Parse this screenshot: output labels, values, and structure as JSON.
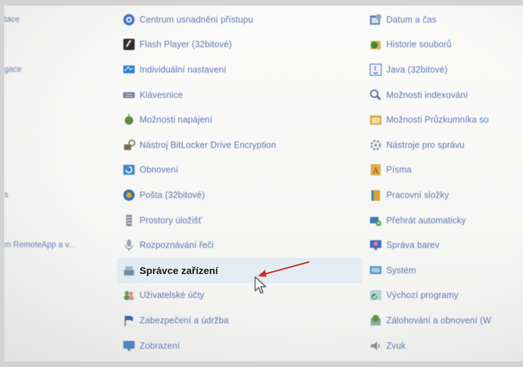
{
  "left_column": [
    {
      "label": "tace",
      "icon": ""
    },
    {
      "label": "",
      "icon": ""
    },
    {
      "label": "gace",
      "icon": ""
    },
    {
      "label": "",
      "icon": ""
    },
    {
      "label": "",
      "icon": ""
    },
    {
      "label": "",
      "icon": ""
    },
    {
      "label": "",
      "icon": ""
    },
    {
      "label": "s",
      "icon": ""
    },
    {
      "label": "",
      "icon": ""
    },
    {
      "label": "m RemoteApp a v...",
      "icon": ""
    },
    {
      "label": "",
      "icon": ""
    },
    {
      "label": "",
      "icon": ""
    },
    {
      "label": "",
      "icon": ""
    },
    {
      "label": "",
      "icon": ""
    }
  ],
  "middle_column": [
    {
      "label": "Centrum usnadnění přístupu",
      "icon": "ease-of-access-icon",
      "color": "#3a6fc4"
    },
    {
      "label": "Flash Player (32bitové)",
      "icon": "flash-player-icon",
      "color": "#2a2a2a"
    },
    {
      "label": "Individuální nastavení",
      "icon": "personalization-icon",
      "color": "#2e7fd6"
    },
    {
      "label": "Klávesnice",
      "icon": "keyboard-icon",
      "color": "#5a6a80"
    },
    {
      "label": "Možnosti napájení",
      "icon": "power-options-icon",
      "color": "#5f8a3a"
    },
    {
      "label": "Nástroj BitLocker Drive Encryption",
      "icon": "bitlocker-icon",
      "color": "#7a6a50"
    },
    {
      "label": "Obnovení",
      "icon": "recovery-icon",
      "color": "#3b86c8"
    },
    {
      "label": "Pošta (32bitové)",
      "icon": "mail-icon",
      "color": "#2f6fb8"
    },
    {
      "label": "Prostory úložišť",
      "icon": "storage-spaces-icon",
      "color": "#8a8a9a"
    },
    {
      "label": "Rozpoznávání řeči",
      "icon": "speech-recognition-icon",
      "color": "#9aa2ad"
    },
    {
      "label": "Správce zařízení",
      "icon": "device-manager-icon",
      "color": "#6a8ca8",
      "selected": true
    },
    {
      "label": "Uživatelské účty",
      "icon": "user-accounts-icon",
      "color": "#6b8e5a"
    },
    {
      "label": "Zabezpečení a údržba",
      "icon": "security-maintenance-flag-icon",
      "color": "#2a5fb0"
    },
    {
      "label": "Zobrazení",
      "icon": "display-icon",
      "color": "#3d7fc0"
    }
  ],
  "right_column": [
    {
      "label": "Datum a čas",
      "icon": "date-time-icon",
      "color": "#5a7bb0"
    },
    {
      "label": "Historie souborů",
      "icon": "file-history-icon",
      "color": "#3a8a3a"
    },
    {
      "label": "Java (32bitové)",
      "icon": "java-icon",
      "color": "#3a6fb0"
    },
    {
      "label": "Možnosti indexování",
      "icon": "indexing-icon",
      "color": "#5b6fa0"
    },
    {
      "label": "Možnosti Průzkumníka so",
      "icon": "explorer-options-icon",
      "color": "#d8a24a"
    },
    {
      "label": "Nástroje pro správu",
      "icon": "admin-tools-icon",
      "color": "#8a9aaa"
    },
    {
      "label": "Písma",
      "icon": "fonts-icon",
      "color": "#d8b04a"
    },
    {
      "label": "Pracovní složky",
      "icon": "work-folders-icon",
      "color": "#d8a030"
    },
    {
      "label": "Přehrát automaticky",
      "icon": "autoplay-icon",
      "color": "#3a7ab0"
    },
    {
      "label": "Správa barev",
      "icon": "color-management-icon",
      "color": "#3f6fb5"
    },
    {
      "label": "Systém",
      "icon": "system-icon",
      "color": "#4a86c8"
    },
    {
      "label": "Výchozí programy",
      "icon": "default-programs-icon",
      "color": "#3a9a5a"
    },
    {
      "label": "Zálohování a obnovení (W",
      "icon": "backup-restore-icon",
      "color": "#5a9a3a"
    },
    {
      "label": "Zvuk",
      "icon": "sound-icon",
      "color": "#8a8a8a"
    }
  ],
  "annotation": {
    "arrow_color": "#cc2a2a"
  },
  "colors": {
    "link": "#5a79b0",
    "selected_text": "#111111",
    "selected_bg": "#e4ecf3"
  }
}
